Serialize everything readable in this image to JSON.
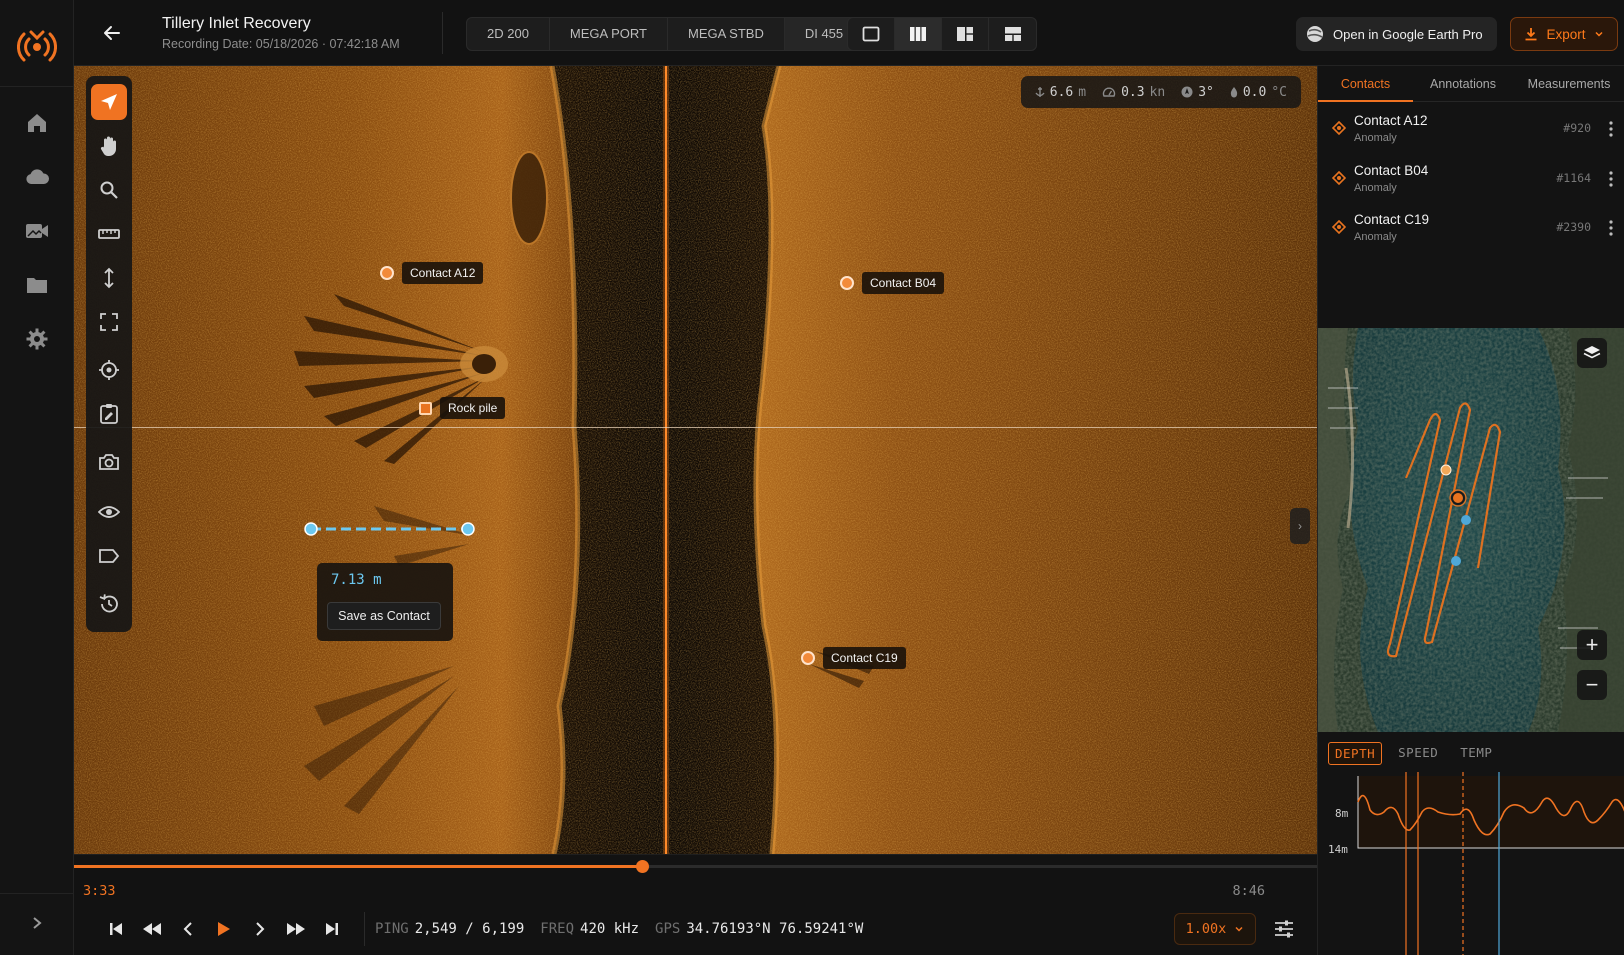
{
  "nav": {
    "items": [
      "home-icon",
      "cloud-icon",
      "video-icon",
      "folder-icon",
      "gear-icon"
    ]
  },
  "header": {
    "title": "Tillery Inlet Recovery",
    "subtitle": "Recording Date: 05/18/2026 · 07:42:18 AM",
    "channels": [
      "2D 200",
      "MEGA PORT",
      "MEGA STBD",
      "DI 455"
    ],
    "active_channel": "DI 455",
    "open_earth_label": "Open in Google Earth Pro",
    "export_label": "Export",
    "accent": "#f07322"
  },
  "readout": {
    "depth": "6.6",
    "depth_unit": "m",
    "speed": "0.3",
    "speed_unit": "kn",
    "heading": "3°",
    "temp": "0.0",
    "temp_unit": "°C"
  },
  "markers": {
    "a12": "Contact A12",
    "b04": "Contact B04",
    "c19": "Contact C19",
    "rock": "Rock pile"
  },
  "measurement": {
    "value": "7.13 m",
    "save_label": "Save as Contact"
  },
  "playback": {
    "current_time": "3:33",
    "end_time": "8:46",
    "progress": 0.457,
    "ping_label": "PING",
    "ping_value": "2,549 / 6,199",
    "freq_label": "FREQ",
    "freq_value": "420 kHz",
    "gps_label": "GPS",
    "gps_value": "34.76193°N 76.59241°W",
    "speed": "1.00x"
  },
  "right": {
    "tabs": [
      "Contacts",
      "Annotations",
      "Measurements"
    ],
    "active_tab": "Contacts",
    "contacts": [
      {
        "name": "Contact A12",
        "type": "Anomaly",
        "id": "#920"
      },
      {
        "name": "Contact B04",
        "type": "Anomaly",
        "id": "#1164"
      },
      {
        "name": "Contact C19",
        "type": "Anomaly",
        "id": "#2390"
      }
    ],
    "graph_tabs": [
      "DEPTH",
      "SPEED",
      "TEMP"
    ],
    "graph_active": "DEPTH",
    "graph_y_labels": [
      "8m",
      "14m"
    ]
  }
}
